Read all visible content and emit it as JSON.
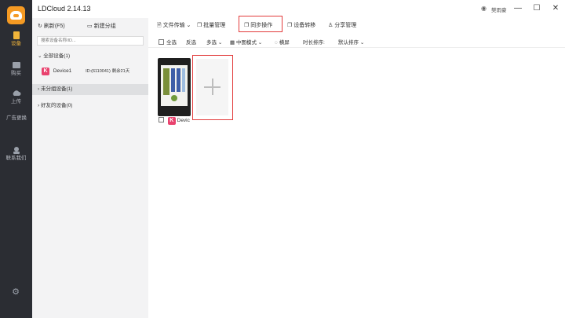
{
  "app": {
    "title": "LDCloud 2.14.13",
    "user": "樊雨豪"
  },
  "rail": {
    "items": [
      {
        "label": "设备",
        "icon": "device-icon",
        "active": true
      },
      {
        "label": "购买",
        "icon": "cart-icon"
      },
      {
        "label": "上传",
        "icon": "upload-icon"
      },
      {
        "label": "广告更换",
        "icon": "ad-icon"
      },
      {
        "label": "联系我们",
        "icon": "contact-icon"
      }
    ],
    "settings_icon": "gear-icon"
  },
  "left": {
    "refresh": "刷新(F5)",
    "new_group": "新建分组",
    "search_placeholder": "搜索设备名称/ID...",
    "all_devices": "全部设备(1)",
    "device": {
      "name": "Device1",
      "id": "ID:(6110041)",
      "remaining": "剩余21天"
    },
    "ungrouped": "未分组设备(1)",
    "friends": "好友的设备(0)"
  },
  "toolbar": {
    "file_transfer": "文件传输",
    "batch_manage": "批量管理",
    "sync_ops": "同步操作",
    "device_transfer": "设备转移",
    "share_manage": "分享管理"
  },
  "filters": {
    "select_all": "全选",
    "invert": "反选",
    "multi": "多选",
    "view_mode": "中图模式",
    "landscape": "横屏",
    "sort_label": "时长排序:",
    "sort_value": "默认排序"
  },
  "card": {
    "label": "Devic"
  },
  "colors": {
    "accent": "#f59a23",
    "highlight": "#e23b3b",
    "badge": "#e9426e"
  }
}
